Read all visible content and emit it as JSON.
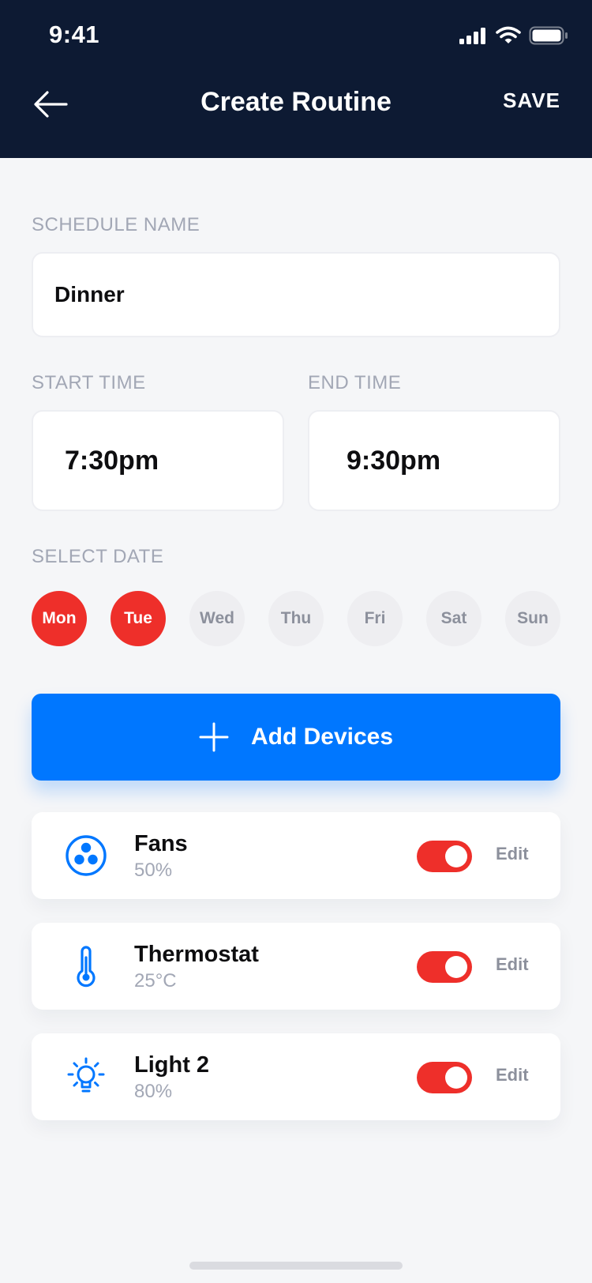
{
  "status_bar": {
    "time": "9:41"
  },
  "header": {
    "title": "Create Routine",
    "save_label": "SAVE"
  },
  "schedule_name": {
    "label": "SCHEDULE NAME",
    "value": "Dinner"
  },
  "start_time": {
    "label": "START TIME",
    "value": "7:30pm"
  },
  "end_time": {
    "label": "END TIME",
    "value": "9:30pm"
  },
  "select_date": {
    "label": "SELECT DATE",
    "days": [
      {
        "label": "Mon",
        "selected": true
      },
      {
        "label": "Tue",
        "selected": true
      },
      {
        "label": "Wed",
        "selected": false
      },
      {
        "label": "Thu",
        "selected": false
      },
      {
        "label": "Fri",
        "selected": false
      },
      {
        "label": "Sat",
        "selected": false
      },
      {
        "label": "Sun",
        "selected": false
      }
    ]
  },
  "add_devices": {
    "label": "Add Devices",
    "icon": "plus-icon"
  },
  "devices": [
    {
      "name": "Fans",
      "value": "50%",
      "icon": "fan-icon",
      "on": true,
      "edit_label": "Edit"
    },
    {
      "name": "Thermostat",
      "value": "25°C",
      "icon": "thermometer-icon",
      "on": true,
      "edit_label": "Edit"
    },
    {
      "name": "Light 2",
      "value": "80%",
      "icon": "light-bulb-icon",
      "on": true,
      "edit_label": "Edit"
    }
  ],
  "colors": {
    "header_bg": "#0D1A33",
    "accent_blue": "#0077FF",
    "active_red": "#EE2F2A",
    "label_gray": "#A2A7B5",
    "background": "#F5F6F8"
  }
}
